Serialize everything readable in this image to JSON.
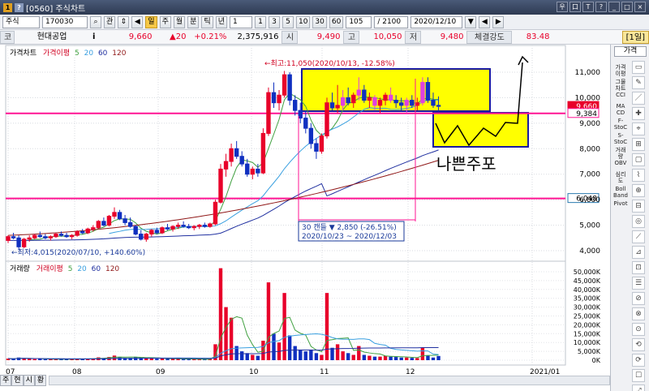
{
  "window": {
    "title": "[0560] 주식차트",
    "buttons": [
      "우",
      "口",
      "T",
      "?",
      "_",
      "□",
      "×"
    ]
  },
  "toolbar": {
    "market": "주식",
    "code": "170030",
    "btn_gwan": "관",
    "periods": [
      "일",
      "주",
      "월",
      "분",
      "틱",
      "년"
    ],
    "selected_period": "일",
    "minute_value": "1",
    "intervals": [
      "1",
      "3",
      "5",
      "10",
      "30",
      "60"
    ],
    "count": "105",
    "total": "/ 2100",
    "date": "2020/12/10",
    "extra": [
      "▼",
      "◀",
      "▶"
    ]
  },
  "info": {
    "code_label": "코",
    "name": "현대공업",
    "info_i": "i",
    "price": "9,660",
    "change": "▲20",
    "change_pct": "+0.21%",
    "volume": "2,375,916",
    "open_label": "시",
    "open": "9,490",
    "high_label": "고",
    "high": "10,050",
    "low_label": "저",
    "low": "9,480",
    "strength_label": "체결강도",
    "strength": "83.48",
    "period_badge": "[1일]"
  },
  "price_legend": {
    "chart": "가격차트",
    "ma_label": "가격이평",
    "ma": [
      "5",
      "20",
      "60",
      "120"
    ]
  },
  "volume_legend": {
    "chart": "거래량",
    "ma_label": "거래이평",
    "ma": [
      "5",
      "20",
      "60",
      "120"
    ]
  },
  "annotations": {
    "high": "←최고:11,050(2020/10/13, -12.58%)",
    "low": "←최저:4,015(2020/07/10, +140.60%)",
    "range_line1": "30 캔들  ▼ 2,850 (-26.51%)",
    "range_line2": "2020/10/23 ~ 2020/12/03",
    "handwritten": "나쁜주포"
  },
  "colors": {
    "up": "#e8002a",
    "down": "#1030c0",
    "ma5": "#40a040",
    "ma20": "#3aa0e0",
    "ma60": "#2030a0",
    "ma120": "#901818",
    "hline": "#ff1493",
    "box": "#ffff00"
  },
  "right_strip": {
    "top_label": "가격",
    "items": [
      "가격\n이평",
      "그물\n차트",
      "CCI",
      "MA\nCD",
      "F-\nStoC",
      "S-\nStoC",
      "거래\n량",
      "OBV",
      "심리\n도",
      "Boll\nBand",
      "Pivot"
    ],
    "icons": [
      "▭",
      "✎",
      "／",
      "✚",
      "⌖",
      "⊞",
      "▢",
      "⌇",
      "⊕",
      "⊟",
      "◎",
      "⟋",
      "⊿",
      "⊡",
      "☰",
      "⊘",
      "⊗",
      "⊙",
      "⟲",
      "⟳",
      "☐",
      "⤢"
    ]
  },
  "bottom_tabs": [
    "주",
    "현",
    "시",
    "황"
  ],
  "chart_data": [
    {
      "type": "candlestick",
      "y_ticks": [
        "11,000",
        "10,000",
        "9,000",
        "8,000",
        "7,000",
        "6,000",
        "5,000",
        "4,000"
      ],
      "ylim": [
        3800,
        11500
      ],
      "x_ticks": [
        "07",
        "08",
        "09",
        "10",
        "11",
        "12",
        "2021/01"
      ],
      "price_tags": [
        "9,660",
        "9,384",
        "6,048"
      ],
      "hlines": [
        9384,
        6048
      ],
      "candles": [
        [
          4400,
          4600,
          4300,
          4550
        ],
        [
          4550,
          4700,
          4450,
          4500
        ],
        [
          4500,
          4600,
          4015,
          4150
        ],
        [
          4150,
          4500,
          4100,
          4450
        ],
        [
          4450,
          4600,
          4350,
          4500
        ],
        [
          4500,
          4650,
          4450,
          4600
        ],
        [
          4600,
          4750,
          4500,
          4550
        ],
        [
          4550,
          4650,
          4450,
          4500
        ],
        [
          4500,
          4600,
          4400,
          4550
        ],
        [
          4550,
          4700,
          4500,
          4650
        ],
        [
          4650,
          4750,
          4550,
          4600
        ],
        [
          4600,
          4700,
          4500,
          4550
        ],
        [
          4550,
          4650,
          4450,
          4600
        ],
        [
          4600,
          4800,
          4550,
          4750
        ],
        [
          4750,
          4850,
          4650,
          4700
        ],
        [
          4700,
          4900,
          4650,
          4850
        ],
        [
          4850,
          5000,
          4750,
          4900
        ],
        [
          4900,
          5200,
          4850,
          5150
        ],
        [
          5150,
          5300,
          4950,
          5000
        ],
        [
          5000,
          5400,
          4950,
          5350
        ],
        [
          5350,
          5700,
          5250,
          5500
        ],
        [
          5500,
          5600,
          5200,
          5250
        ],
        [
          5250,
          5400,
          5000,
          5100
        ],
        [
          5100,
          5300,
          4900,
          4950
        ],
        [
          4950,
          5000,
          4600,
          4650
        ],
        [
          4650,
          4800,
          4400,
          4450
        ],
        [
          4450,
          4700,
          4350,
          4650
        ],
        [
          4650,
          4850,
          4550,
          4800
        ],
        [
          4800,
          4900,
          4650,
          4700
        ],
        [
          4700,
          4950,
          4650,
          4900
        ],
        [
          4900,
          5050,
          4800,
          4850
        ],
        [
          4850,
          5000,
          4750,
          4950
        ],
        [
          4950,
          5100,
          4850,
          5000
        ],
        [
          5000,
          5150,
          4900,
          4950
        ],
        [
          4950,
          5050,
          4850,
          4900
        ],
        [
          4900,
          5000,
          4800,
          4950
        ],
        [
          4950,
          5050,
          4850,
          5000
        ],
        [
          5000,
          5100,
          4900,
          4950
        ],
        [
          4950,
          5100,
          4900,
          5050
        ],
        [
          5050,
          6000,
          5000,
          5900
        ],
        [
          5900,
          7400,
          5850,
          7200
        ],
        [
          7200,
          7800,
          6900,
          7500
        ],
        [
          7500,
          8200,
          7300,
          8000
        ],
        [
          8000,
          8300,
          7600,
          7700
        ],
        [
          7700,
          7900,
          7300,
          7400
        ],
        [
          7400,
          7600,
          6900,
          7000
        ],
        [
          7000,
          7300,
          6800,
          7200
        ],
        [
          7200,
          7400,
          6900,
          7050
        ],
        [
          7050,
          8800,
          7000,
          8600
        ],
        [
          8600,
          10400,
          8500,
          10200
        ],
        [
          10200,
          10600,
          9600,
          9800
        ],
        [
          9800,
          10300,
          9500,
          10100
        ],
        [
          10100,
          11050,
          10000,
          10900
        ],
        [
          10900,
          11000,
          9700,
          9900
        ],
        [
          9900,
          10100,
          9300,
          9500
        ],
        [
          9500,
          9800,
          9000,
          9200
        ],
        [
          9200,
          9500,
          8600,
          8800
        ],
        [
          8800,
          9000,
          8000,
          8200
        ],
        [
          8200,
          8400,
          7600,
          7900
        ],
        [
          7900,
          8600,
          7800,
          8500
        ],
        [
          8500,
          10000,
          8400,
          9800
        ],
        [
          9800,
          10200,
          9500,
          9600
        ],
        [
          9600,
          10500,
          9400,
          9700
        ],
        [
          9700,
          10300,
          9500,
          10000
        ],
        [
          10000,
          10400,
          9700,
          9800
        ],
        [
          9800,
          10200,
          9600,
          10100
        ],
        [
          10100,
          10800,
          9900,
          10300
        ],
        [
          10300,
          10500,
          9800,
          9900
        ],
        [
          9900,
          10200,
          9600,
          10000
        ],
        [
          10000,
          10100,
          9500,
          9700
        ],
        [
          9700,
          10000,
          9400,
          9900
        ],
        [
          9900,
          10200,
          9700,
          10100
        ],
        [
          10100,
          10400,
          9800,
          9900
        ],
        [
          9900,
          10100,
          9600,
          9800
        ],
        [
          9800,
          10000,
          9500,
          9700
        ],
        [
          9700,
          10000,
          9400,
          9900
        ],
        [
          9900,
          10100,
          9600,
          9700
        ],
        [
          9700,
          10000,
          9500,
          9800
        ],
        [
          9800,
          10800,
          9700,
          10600
        ],
        [
          10600,
          10800,
          9800,
          9900
        ],
        [
          9900,
          10200,
          9600,
          9700
        ],
        [
          9700,
          10050,
          9480,
          9660
        ]
      ],
      "ma5_start": 4,
      "ma20_start": 19
    },
    {
      "type": "bar",
      "y_ticks": [
        "50,000K",
        "45,000K",
        "40,000K",
        "35,000K",
        "30,000K",
        "25,000K",
        "20,000K",
        "15,000K",
        "10,000K",
        "5,000K",
        "0K"
      ],
      "ylim": [
        0,
        55000
      ],
      "volumes": [
        900,
        700,
        1500,
        1100,
        800,
        600,
        700,
        500,
        500,
        700,
        600,
        500,
        500,
        900,
        700,
        900,
        1000,
        1600,
        1200,
        1800,
        2600,
        1800,
        1300,
        1400,
        1800,
        1600,
        1200,
        1100,
        800,
        900,
        700,
        700,
        800,
        600,
        500,
        500,
        600,
        500,
        600,
        9000,
        52000,
        30000,
        24000,
        8000,
        5000,
        4000,
        3000,
        2500,
        11000,
        44000,
        15000,
        10000,
        38000,
        14000,
        8000,
        6000,
        5000,
        6000,
        4000,
        3000,
        38000,
        7000,
        9000,
        5000,
        4000,
        3000,
        8000,
        3000,
        2500,
        2000,
        2000,
        2500,
        2000,
        1800,
        1500,
        1500,
        1300,
        1200,
        7000,
        2500,
        1500,
        2375
      ]
    }
  ]
}
